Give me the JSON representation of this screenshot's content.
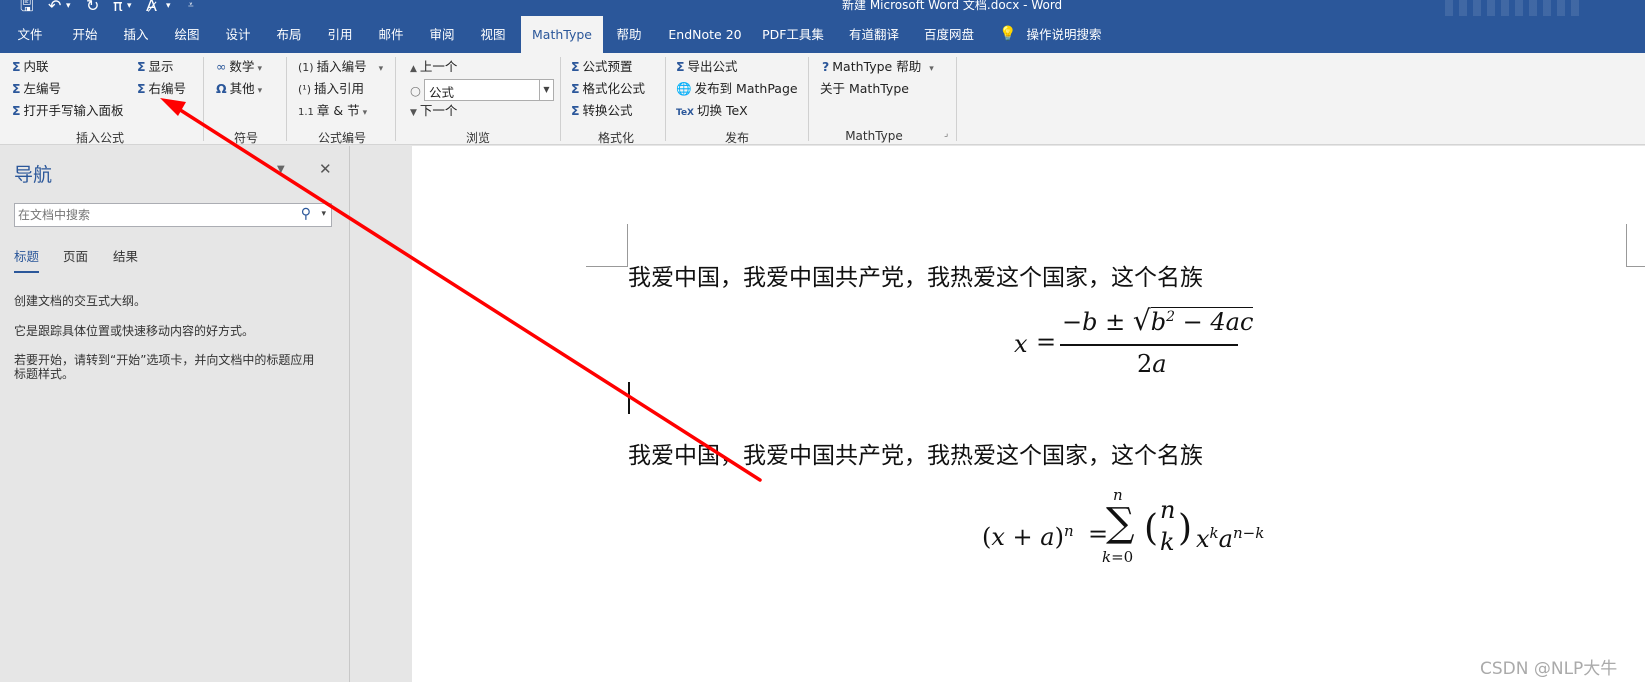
{
  "window": {
    "title": "新建 Microsoft Word 文档.docx  -  Word"
  },
  "tabs": [
    "文件",
    "开始",
    "插入",
    "绘图",
    "设计",
    "布局",
    "引用",
    "邮件",
    "审阅",
    "视图",
    "MathType",
    "帮助",
    "EndNote 20",
    "PDF工具集",
    "有道翻译",
    "百度网盘"
  ],
  "active_tab": "MathType",
  "tell_me": "操作说明搜索",
  "ribbon": {
    "insert_equation": {
      "label": "插入公式",
      "inline": "内联",
      "display": "显示",
      "left_numbered": "左编号",
      "right_numbered": "右编号",
      "handwriting": "打开手写输入面板"
    },
    "symbols": {
      "label": "符号",
      "math": "数学",
      "other": "其他"
    },
    "equation_numbers": {
      "label": "公式编号",
      "insert_number": "插入编号",
      "insert_reference": "插入引用",
      "chapter_section": "章 & 节"
    },
    "browse": {
      "label": "浏览",
      "previous": "上一个",
      "combo_value": "公式",
      "next": "下一个"
    },
    "format": {
      "label": "格式化",
      "presets": "公式预置",
      "format_equations": "格式化公式",
      "convert_equations": "转换公式"
    },
    "publish": {
      "label": "发布",
      "export": "导出公式",
      "publish_mathpage": "发布到 MathPage",
      "toggle_tex": "切换 TeX"
    },
    "mathtype": {
      "label": "MathType",
      "help": "MathType 帮助",
      "about": "关于 MathType"
    }
  },
  "nav_pane": {
    "title": "导航",
    "search_placeholder": "在文档中搜索",
    "tabs": [
      "标题",
      "页面",
      "结果"
    ],
    "active_tab": "标题",
    "hint1": "创建文档的交互式大纲。",
    "hint2": "它是跟踪具体位置或快速移动内容的好方式。",
    "hint3": "若要开始，请转到“开始”选项卡，并向文档中的标题应用标题样式。"
  },
  "document": {
    "line1": "我爱中国，我爱中国共产党，我热爱这个国家，这个名族",
    "line2": "我爱中国，我爱中国共产党，我热爱这个国家，这个名族",
    "equation1": "x = (−b ± √(b² − 4ac)) / 2a",
    "equation2": "(x + a)^n = Σ_{k=0}^{n} (n k) x^k a^{n−k}"
  },
  "watermark": "CSDN @NLP大牛",
  "colors": {
    "brand": "#2b579a",
    "ribbon_bg": "#f3f3f3",
    "annotation_arrow": "#ff0000"
  }
}
